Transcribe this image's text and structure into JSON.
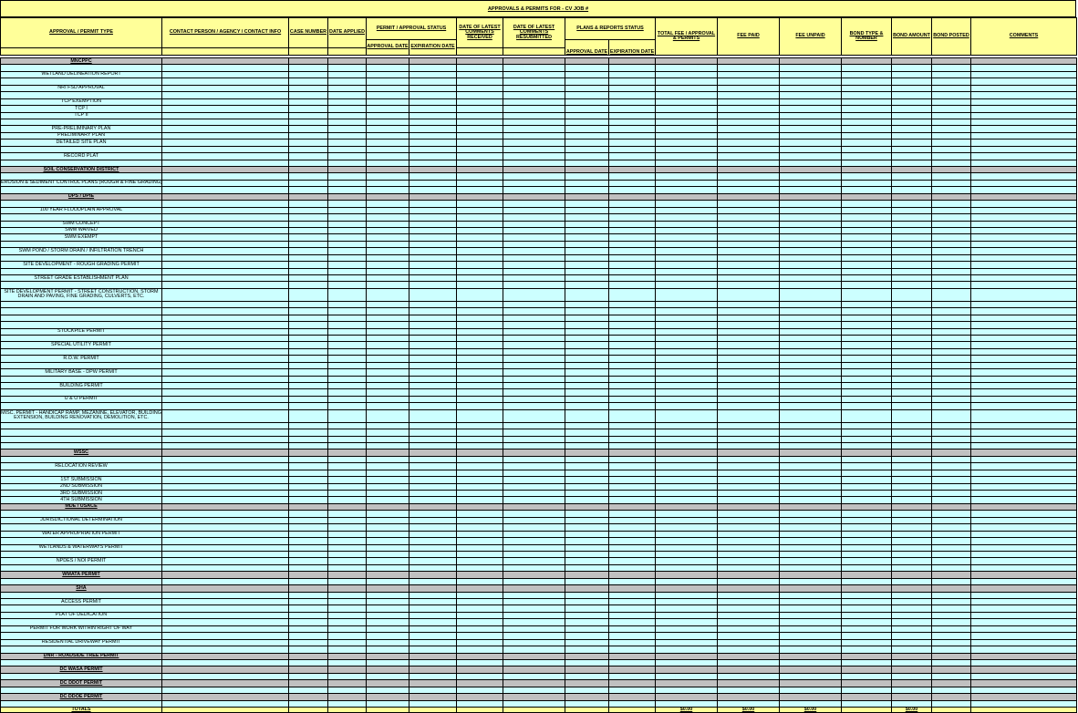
{
  "title": "APPROVALS & PERMITS FOR  - CV JOB #",
  "headers": {
    "approval_type": "APPROVAL / PERMIT TYPE",
    "contact": "CONTACT PERSON / AGENCY / CONTACT INFO",
    "case_number": "CASE NUMBER",
    "date_applied": "DATE APPLIED",
    "permit_status": "PERMIT / APPROVAL STATUS",
    "approval_date": "APPROVAL DATE",
    "expiration_date": "EXPIRATION DATE",
    "latest_comments_received": "DATE OF LATEST COMMENTS RECEIVED",
    "latest_comments_resubmitted": "DATE OF LATEST COMMENTS RESUBMITTED",
    "plans_status": "PLANS & REPORTS STATUS",
    "plans_approval_date": "APPROVAL DATE",
    "plans_expiration_date": "EXPIRATION DATE",
    "total_fee": "TOTAL  FEE / APPROVAL & PERMITS",
    "fee_paid": "FEE PAID",
    "fee_unpaid": "FEE UNPAID",
    "bond_type": "BOND TYPE & NUMBER",
    "bond_amount": "BOND AMOUNT",
    "bond_posted": "BOND POSTED",
    "comments": "COMMENTS"
  },
  "rows": [
    {
      "t": "sec",
      "label": "MNCPPC"
    },
    {
      "t": "blank"
    },
    {
      "t": "item",
      "label": "WETLAND DELINEATION REPORT"
    },
    {
      "t": "blank"
    },
    {
      "t": "item",
      "label": "NRI FSD APPROVAL"
    },
    {
      "t": "blank"
    },
    {
      "t": "item",
      "label": "TCP EXEMPTION"
    },
    {
      "t": "item",
      "label": "TCP I"
    },
    {
      "t": "item",
      "label": "TCP II"
    },
    {
      "t": "blank"
    },
    {
      "t": "item",
      "label": "PRE-PRELIMINARY PLAN"
    },
    {
      "t": "item",
      "label": "PRELIMINARY PLAN"
    },
    {
      "t": "item",
      "label": "DETAILED SITE PLAN"
    },
    {
      "t": "blank"
    },
    {
      "t": "item",
      "label": "RECORD PLAT"
    },
    {
      "t": "blank"
    },
    {
      "t": "sec",
      "label": "SOIL CONSERVATION DISTRICT"
    },
    {
      "t": "blank"
    },
    {
      "t": "item",
      "label": "EROSION & SEDIMENT CONTROL PLANS (ROUGH & FINE GRADING)"
    },
    {
      "t": "blank"
    },
    {
      "t": "sec",
      "label": "DPS / DPIE"
    },
    {
      "t": "blank"
    },
    {
      "t": "item",
      "label": "100 YEAR FLOODPLAIN APPROVAL"
    },
    {
      "t": "blank"
    },
    {
      "t": "item",
      "label": "SWM CONCEPT"
    },
    {
      "t": "item",
      "label": "SWM WAIVED"
    },
    {
      "t": "item",
      "label": "SWM EXEMPT"
    },
    {
      "t": "blank"
    },
    {
      "t": "item",
      "label": "SWM POND / STORM DRAIN / INFILTRATION TRENCH"
    },
    {
      "t": "blank"
    },
    {
      "t": "item",
      "label": "SITE DEVELOPMENT - ROUGH GRADING PERMIT"
    },
    {
      "t": "blank"
    },
    {
      "t": "item",
      "label": "STREET GRADE ESTABLISHMENT PLAN"
    },
    {
      "t": "blank"
    },
    {
      "t": "item2",
      "label": "SITE DEVELOPMENT PERMIT - STREET CONSTRUCTION, STORM DRAIN AND PAVING, FINE GRADING, CULVERTS, ETC."
    },
    {
      "t": "blank"
    },
    {
      "t": "blank"
    },
    {
      "t": "blank"
    },
    {
      "t": "blank"
    },
    {
      "t": "item",
      "label": "STOCKPILE PERMIT"
    },
    {
      "t": "blank"
    },
    {
      "t": "item",
      "label": "SPECIAL UTILITY PERMIT"
    },
    {
      "t": "blank"
    },
    {
      "t": "item",
      "label": "R.O.W. PERMIT"
    },
    {
      "t": "blank"
    },
    {
      "t": "item",
      "label": "MILITARY BASE - DPW PERMIT"
    },
    {
      "t": "blank"
    },
    {
      "t": "item",
      "label": "BUILDING PERMIT"
    },
    {
      "t": "blank"
    },
    {
      "t": "item",
      "label": "U & O PERMIT"
    },
    {
      "t": "blank"
    },
    {
      "t": "item2",
      "label": "MISC. PERMIT - HANDICAP RAMP, MEZANINE, ELEVATOR, BUILDING EXTENSION, BUILDING RENOVATION, DEMOLITION, ETC."
    },
    {
      "t": "blank"
    },
    {
      "t": "blank"
    },
    {
      "t": "blank"
    },
    {
      "t": "blank"
    },
    {
      "t": "sec",
      "label": "WSSC"
    },
    {
      "t": "blank"
    },
    {
      "t": "item",
      "label": "RELOCATION REVIEW"
    },
    {
      "t": "blank"
    },
    {
      "t": "item",
      "label": "1ST SUBMISSION"
    },
    {
      "t": "item",
      "label": "2ND SUBMISSION"
    },
    {
      "t": "item",
      "label": "3RD SUBMISSION"
    },
    {
      "t": "item",
      "label": "4TH SUBMISSION"
    },
    {
      "t": "sec",
      "label": "MDE / USACE"
    },
    {
      "t": "blank"
    },
    {
      "t": "item",
      "label": "JURISDICTIONAL DETERMINATION"
    },
    {
      "t": "blank"
    },
    {
      "t": "item",
      "label": "WATER APPROPRIATION PERMIT"
    },
    {
      "t": "blank"
    },
    {
      "t": "item",
      "label": "WETLANDS & WATERWAYS PERMIT"
    },
    {
      "t": "blank"
    },
    {
      "t": "item",
      "label": "NPDES / NOI PERMIT"
    },
    {
      "t": "blank"
    },
    {
      "t": "sec",
      "label": "WMATA PERMIT"
    },
    {
      "t": "blank"
    },
    {
      "t": "sec",
      "label": "SHA"
    },
    {
      "t": "blank"
    },
    {
      "t": "item",
      "label": "ACCESS PERMIT"
    },
    {
      "t": "blank"
    },
    {
      "t": "item",
      "label": "PLAT OF DEDICATION"
    },
    {
      "t": "blank"
    },
    {
      "t": "item",
      "label": "PERMIT FOR WORK WITHIN RIGHT OF WAY"
    },
    {
      "t": "blank"
    },
    {
      "t": "item",
      "label": "RESIDENTIAL DRIVEWAY PERMIT"
    },
    {
      "t": "blank"
    },
    {
      "t": "sec",
      "label": "DNR - ROADSIDE TREE PERMIT"
    },
    {
      "t": "blank"
    },
    {
      "t": "sec",
      "label": "DC WASA PERMIT"
    },
    {
      "t": "blank"
    },
    {
      "t": "sec",
      "label": "DC DDOT PERMIT"
    },
    {
      "t": "blank"
    },
    {
      "t": "sec",
      "label": "DC DDOE PERMIT"
    },
    {
      "t": "blank"
    }
  ],
  "totals": {
    "label": "TOTALS",
    "total_fee": "$0.00",
    "fee_paid": "$0.00",
    "fee_unpaid": "$0.00",
    "bond_amount": "$0.00"
  }
}
